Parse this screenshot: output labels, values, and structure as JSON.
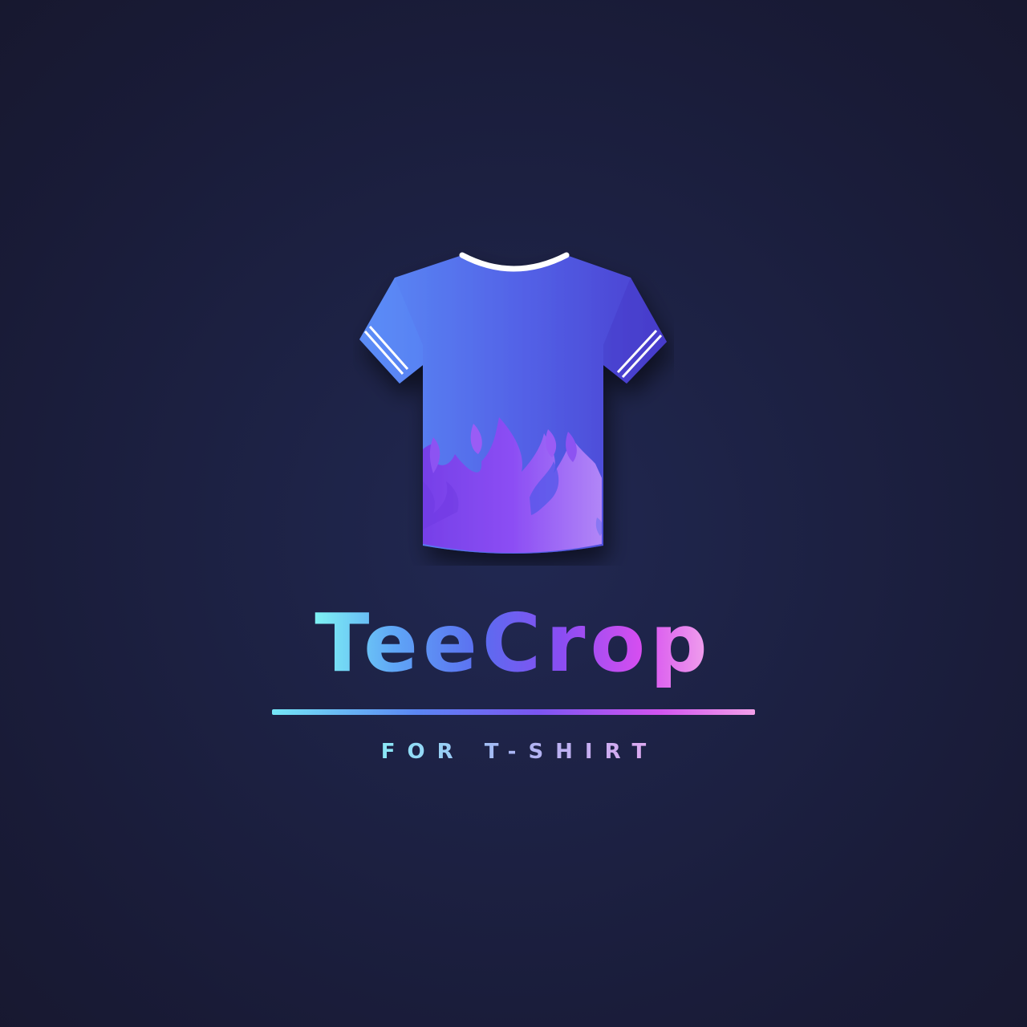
{
  "logo": {
    "brand_name": "TeeCrop",
    "tagline": "FOR T-SHIRT",
    "icon": "t-shirt-flame-icon"
  },
  "colors": {
    "background": "#1b1e3d",
    "shirt_light": "#5b8af5",
    "shirt_dark": "#4f46d6",
    "flame_violet": "#8b4ff2",
    "flame_pink": "#b27af5",
    "collar_trim": "#ffffff",
    "accent_cyan": "#7ef2f4",
    "accent_pink": "#f2a6ec"
  }
}
